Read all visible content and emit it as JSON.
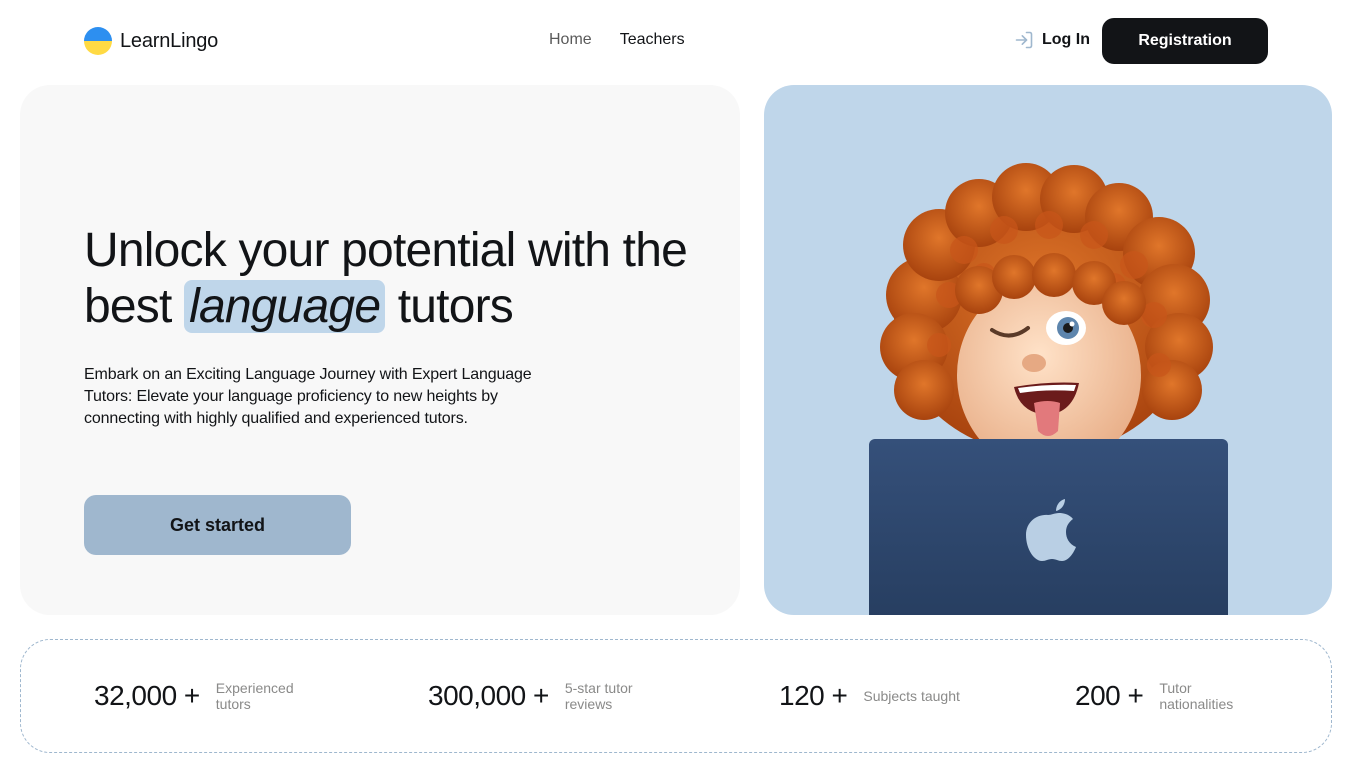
{
  "colors": {
    "accent": "#bfd6ea",
    "accent_dark": "#9fb7ce",
    "dark": "#121417",
    "muted": "#8a8a89",
    "surface": "#f8f8f8",
    "flag_blue": "#2d8ff0",
    "flag_yellow": "#ffda44",
    "laptop": "#2d466b"
  },
  "header": {
    "logo_text": "LearnLingo",
    "nav": [
      {
        "label": "Home",
        "icon": null
      },
      {
        "label": "Teachers",
        "icon": null
      }
    ],
    "login_label": "Log In",
    "login_icon": "login-arrow-icon",
    "register_label": "Registration"
  },
  "hero": {
    "title_before": "Unlock your potential with the best ",
    "title_highlight": "language",
    "title_after": " tutors",
    "description": "Embark on an Exciting Language Journey with Expert Language Tutors: Elevate your language proficiency to new heights by connecting with highly qualified and experienced tutors.",
    "cta_label": "Get started"
  },
  "stats": [
    {
      "value": "32,000 +",
      "label": "Experienced tutors"
    },
    {
      "value": "300,000 +",
      "label": "5-star tutor reviews"
    },
    {
      "value": "120 +",
      "label": "Subjects taught"
    },
    {
      "value": "200 +",
      "label": "Tutor nationalities"
    }
  ]
}
